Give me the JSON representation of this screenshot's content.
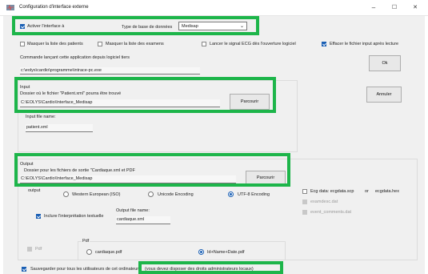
{
  "window": {
    "title": "Configuration d'interface externe",
    "minimize": "–",
    "maximize": "☐",
    "close": "✕"
  },
  "top": {
    "activate_label": "Activer l'interface à",
    "db_type_label": "Type de base de données",
    "db_type_value": "Medisap",
    "hide_patients_label": "Masquer la liste des patients",
    "hide_exams_label": "Masquer la liste des examens",
    "launch_ecg_label": "Lancer le signal ECG dès l'ouverture logiciel",
    "delete_input_label": "Effacer le fichier input après lecture",
    "command_label": "Commande lançant cette application depuis logiciel tiers",
    "command_value": "c:\\eolys\\cardio\\programme\\intrace-pc.exe",
    "ok_label": "Ok",
    "cancel_label": "Annuler"
  },
  "input": {
    "group_title": "Input",
    "folder_label": "Dossier où le fichier \"Patient.xml\" pourra être trouvé",
    "folder_value": "C:\\EOLYS\\Cardio\\Interface_Medisap",
    "browse_label": "Parcourir",
    "file_name_label": "Input file name:",
    "file_name_value": "patient.xml"
  },
  "output": {
    "group_title": "Output",
    "folder_label": "Dossier pour les fichiers de sortie \"Cardiaque.xml et PDF",
    "folder_value": "C:\\EOLYS\\Cardio\\Interface_Medisap",
    "browse_label": "Parcourir",
    "encoding_label": "output",
    "enc_western": "Western European (ISO)",
    "enc_unicode": "Unicode Encoding",
    "enc_utf8": "UTF-8 Encoding",
    "include_interp_label": "Inclure l'interprétation textuelle",
    "file_name_label": "Output file name:",
    "file_name_value": "cardiaque.xml",
    "ecg_data_label": "Ecg data: ecgdata.scp",
    "or_label": "or",
    "ecg_hex_label": "ecgdata.hex",
    "exams_label": "examdesc.dat",
    "event_label": "event_comments.dat",
    "pdf_group_label": "Pdf",
    "pdf_check_label": "Pdf",
    "pdf_opt1": "cardiaque.pdf",
    "pdf_opt2": "Id+Name+Date.pdf"
  },
  "bottom": {
    "save_all_part1": "Sauvegarder pour tous les utilisateurs de cet ordinateur",
    "save_all_part2": "(vous devez disposer des droits administrateurs locaux)"
  },
  "colors": {
    "highlight": "#1db54a",
    "accent": "#1a5fb4"
  }
}
